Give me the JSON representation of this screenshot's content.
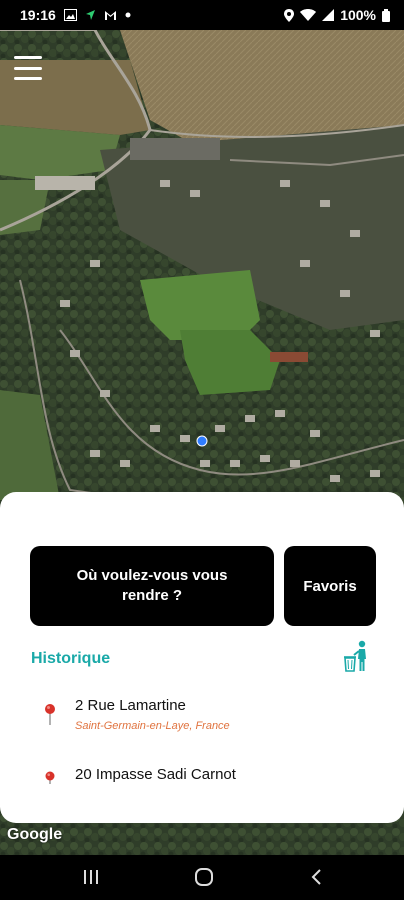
{
  "status_bar": {
    "time": "19:16",
    "battery": "100%",
    "icons": [
      "image-icon",
      "location-arrow-icon",
      "gmail-icon",
      "dot-icon",
      "location-pin-icon",
      "wifi-icon",
      "signal-icon",
      "battery-icon"
    ]
  },
  "map": {
    "menu_icon": "hamburger-menu-icon",
    "attribution": "Google"
  },
  "sheet": {
    "destination_label": "Où voulez-vous vous rendre ?",
    "favorites_label": "Favoris",
    "history_title": "Historique",
    "clear_icon": "trash-person-icon",
    "history": [
      {
        "address": "2 Rue Lamartine",
        "city": "Saint-Germain-en-Laye, France"
      },
      {
        "address": "20 Impasse Sadi Carnot",
        "city": ""
      }
    ]
  },
  "nav_bar": {
    "icons": [
      "recent-apps-icon",
      "home-icon",
      "back-icon"
    ]
  },
  "colors": {
    "accent": "#1aa9a8",
    "city_text": "#e0733f",
    "pin": "#d8322a"
  }
}
